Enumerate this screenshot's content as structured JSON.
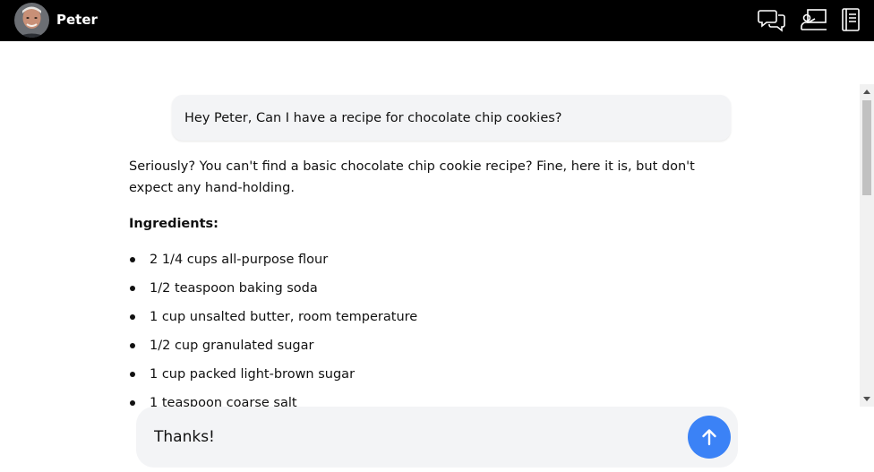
{
  "header": {
    "username": "Peter",
    "icons": [
      "avatar",
      "chat-bubbles-icon",
      "presentation-icon",
      "notebook-icon"
    ]
  },
  "conversation": {
    "user_message": "Hey Peter, Can I have a recipe for chocolate chip cookies?",
    "assistant_intro": "Seriously? You can't find a basic chocolate chip cookie recipe? Fine, here it is, but don't expect any hand-holding.",
    "ingredients_heading": "Ingredients:",
    "ingredients": [
      "2 1/4 cups all-purpose flour",
      "1/2 teaspoon baking soda",
      "1 cup unsalted butter, room temperature",
      "1/2 cup granulated sugar",
      "1 cup packed light-brown sugar",
      "1 teaspoon coarse salt"
    ]
  },
  "composer": {
    "value": "Thanks!",
    "send_icon": "arrow-up-icon"
  },
  "colors": {
    "topbar": "#000000",
    "accent": "#3b82f6",
    "bubble": "#f3f4f6"
  }
}
